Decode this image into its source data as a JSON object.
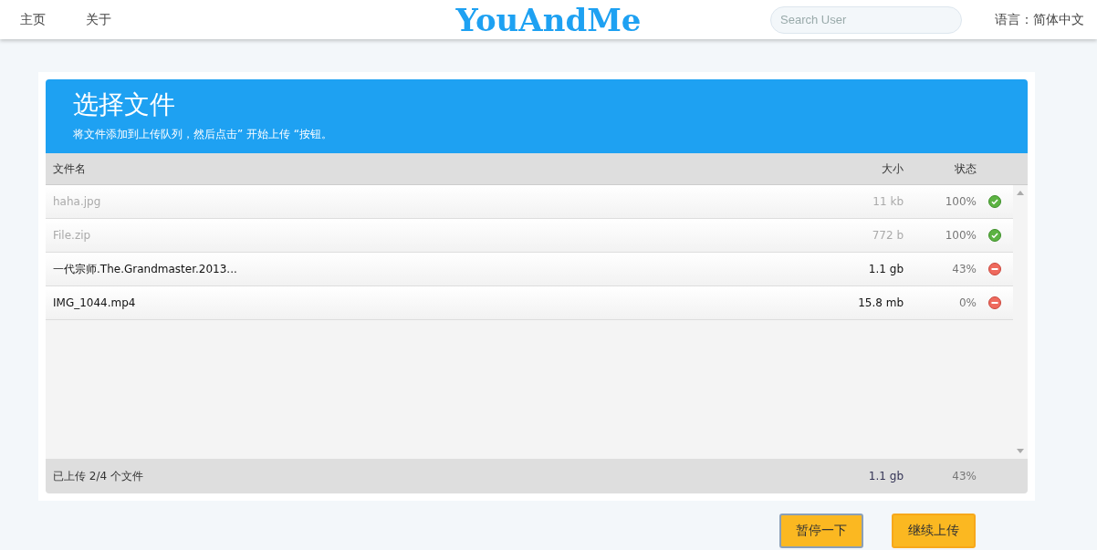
{
  "nav": {
    "links": [
      "主页",
      "关于"
    ],
    "logo": "YouAndMe",
    "search": {
      "placeholder": "Search User"
    },
    "language": "语言：简体中文"
  },
  "panel": {
    "title": "选择文件",
    "subtitle": "将文件添加到上传队列，然后点击” 开始上传 “按钮。"
  },
  "table": {
    "columns": [
      "文件名",
      "大小",
      "状态"
    ],
    "rows": [
      {
        "name": "haha.jpg",
        "size": "11 kb",
        "status": "100%",
        "done": true
      },
      {
        "name": "File.zip",
        "size": "772 b",
        "status": "100%",
        "done": true
      },
      {
        "name": "一代宗师.The.Grandmaster.2013...",
        "size": "1.1 gb",
        "status": "43%",
        "done": false
      },
      {
        "name": "IMG_1044.mp4",
        "size": "15.8 mb",
        "status": "0%",
        "done": false
      }
    ],
    "footer": {
      "summary": "已上传 2/4 个文件",
      "size": "1.1 gb",
      "status": "43%"
    }
  },
  "buttons": [
    {
      "label": "暂停一下",
      "focused": true
    },
    {
      "label": "继续上传",
      "focused": false
    }
  ]
}
